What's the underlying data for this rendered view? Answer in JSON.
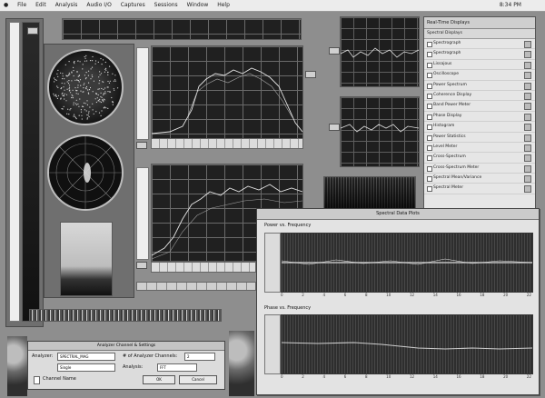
{
  "menubar": {
    "apple": "",
    "items": [
      "File",
      "Edit",
      "Analysis",
      "Audio I/O",
      "Captures",
      "Sessions",
      "Window",
      "Help"
    ],
    "clock": "8:34 PM"
  },
  "sources_list": {
    "header": "Real-Time Displays",
    "subheader": "Spectral Displays",
    "items": [
      "Spectrograph",
      "Spectrograph",
      "Lissajous",
      "Oscilloscope",
      "Power Spectrum",
      "Coherence Display",
      "Band Power Meter",
      "Phase Display",
      "Histogram",
      "Power Statistics",
      "Level Meter",
      "Cross-Spectrum",
      "Cross-Spectrum Meter",
      "Spectral Mean/Variance",
      "Spectral Meter"
    ]
  },
  "freq_window": {
    "title": "Spectral Data Plots",
    "plot1_label": "Power vs. Frequency",
    "plot2_label": "Phase vs. Frequency",
    "x_ticks": [
      "0",
      "2",
      "4",
      "6",
      "8",
      "10",
      "12",
      "14",
      "16",
      "18",
      "20",
      "22"
    ]
  },
  "dialog": {
    "title": "Analyzer Channel & Settings",
    "field1_label": "Analyzer:",
    "field1_value": "SPECTRAL_MAG",
    "field2_label": "# of Analyzer Channels:",
    "field2_value": "2",
    "field3_label": "",
    "field3_value": "Single",
    "field4_label": "Analysis:",
    "field4_value": "FFT",
    "checkbox_label": "Channel Name",
    "ok_label": "OK",
    "cancel_label": "Cancel"
  },
  "colors": {
    "desktop": "#8e8e8e",
    "plot_bg": "#202020",
    "trace": "#e6e6e6"
  }
}
